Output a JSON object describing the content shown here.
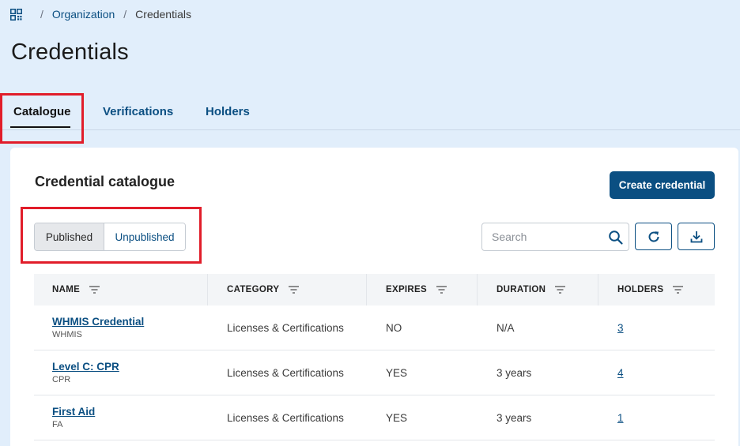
{
  "breadcrumb": {
    "icon": "grid-icon",
    "items": [
      "Organization",
      "Credentials"
    ]
  },
  "page": {
    "title": "Credentials"
  },
  "tabs": [
    {
      "label": "Catalogue",
      "active": true
    },
    {
      "label": "Verifications",
      "active": false
    },
    {
      "label": "Holders",
      "active": false
    }
  ],
  "card": {
    "title": "Credential catalogue",
    "create_label": "Create credential",
    "filter": {
      "published": "Published",
      "unpublished": "Unpublished",
      "selected": "Published"
    },
    "search": {
      "placeholder": "Search"
    },
    "icons": {
      "search": "search-icon",
      "refresh": "refresh-icon",
      "download": "download-icon"
    }
  },
  "table": {
    "columns": [
      "NAME",
      "CATEGORY",
      "EXPIRES",
      "DURATION",
      "HOLDERS"
    ],
    "rows": [
      {
        "name": "WHMIS Credential",
        "code": "WHMIS",
        "category": "Licenses & Certifications",
        "expires": "NO",
        "duration": "N/A",
        "holders": "3"
      },
      {
        "name": "Level C: CPR",
        "code": "CPR",
        "category": "Licenses & Certifications",
        "expires": "YES",
        "duration": "3 years",
        "holders": "4"
      },
      {
        "name": "First Aid",
        "code": "FA",
        "category": "Licenses & Certifications",
        "expires": "YES",
        "duration": "3 years",
        "holders": "1"
      }
    ]
  },
  "colors": {
    "primary": "#0b4f82",
    "page_bg": "#e1eefb",
    "highlight": "#e11d2a"
  }
}
